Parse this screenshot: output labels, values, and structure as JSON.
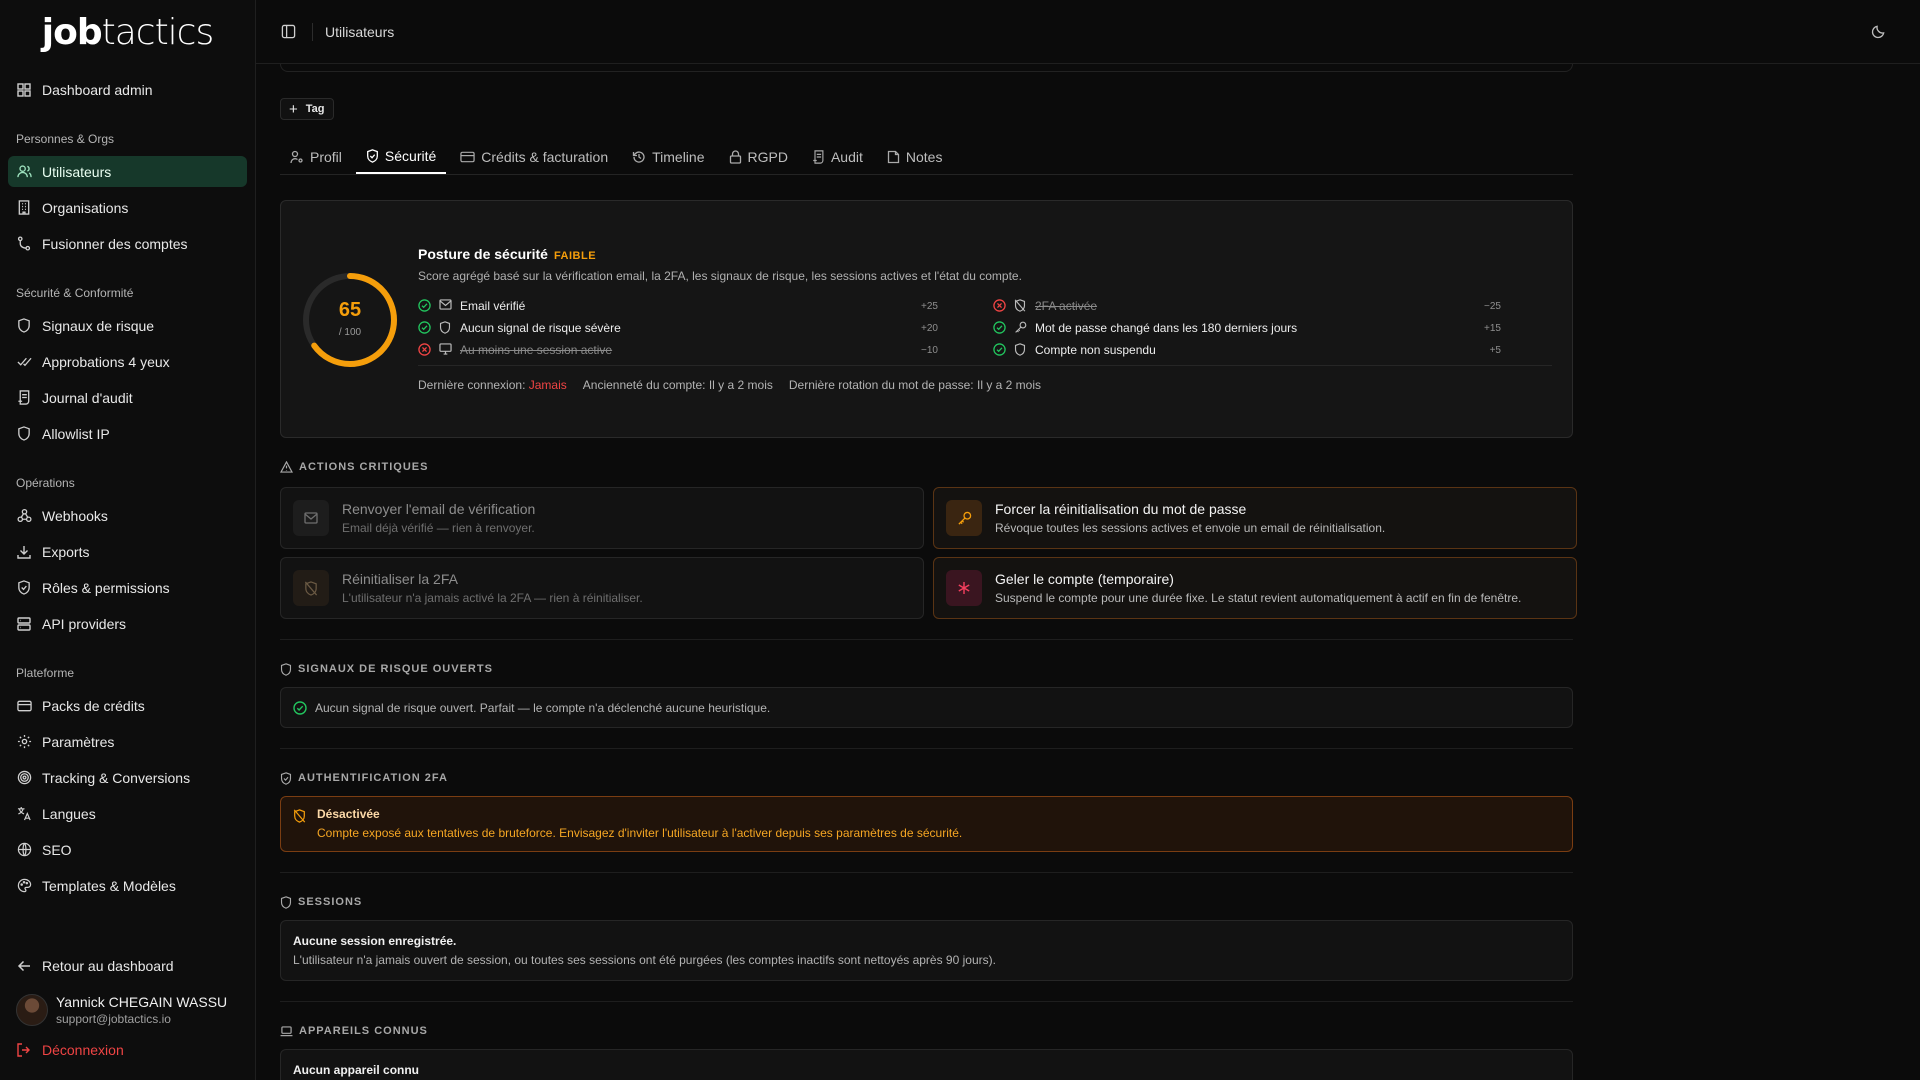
{
  "brand": {
    "part1": "job",
    "part2": "tactics"
  },
  "sidebar": {
    "top_item": {
      "label": "Dashboard admin",
      "icon": "grid-icon"
    },
    "sections": [
      {
        "title": "Personnes & Orgs",
        "items": [
          {
            "label": "Utilisateurs",
            "icon": "users-icon",
            "active": true
          },
          {
            "label": "Organisations",
            "icon": "building-icon"
          },
          {
            "label": "Fusionner des comptes",
            "icon": "merge-icon"
          }
        ]
      },
      {
        "title": "Sécurité & Conformité",
        "items": [
          {
            "label": "Signaux de risque",
            "icon": "shield-icon"
          },
          {
            "label": "Approbations 4 yeux",
            "icon": "double-check-icon"
          },
          {
            "label": "Journal d'audit",
            "icon": "scroll-icon"
          },
          {
            "label": "Allowlist IP",
            "icon": "shield-icon"
          }
        ]
      },
      {
        "title": "Opérations",
        "items": [
          {
            "label": "Webhooks",
            "icon": "webhook-icon"
          },
          {
            "label": "Exports",
            "icon": "download-icon"
          },
          {
            "label": "Rôles & permissions",
            "icon": "shield-check-icon"
          },
          {
            "label": "API providers",
            "icon": "server-icon"
          }
        ]
      },
      {
        "title": "Plateforme",
        "items": [
          {
            "label": "Packs de crédits",
            "icon": "card-icon"
          },
          {
            "label": "Paramètres",
            "icon": "gear-icon"
          },
          {
            "label": "Tracking & Conversions",
            "icon": "target-icon"
          },
          {
            "label": "Langues",
            "icon": "translate-icon"
          },
          {
            "label": "SEO",
            "icon": "globe-icon"
          },
          {
            "label": "Templates & Modèles",
            "icon": "palette-icon"
          }
        ]
      }
    ],
    "back_label": "Retour au dashboard",
    "user": {
      "name": "Yannick CHEGAIN WASSU",
      "email": "support@jobtactics.io"
    },
    "logout_label": "Déconnexion"
  },
  "topbar": {
    "breadcrumb": "Utilisateurs"
  },
  "tag_button": {
    "label": "Tag"
  },
  "tabs": [
    {
      "label": "Profil",
      "icon": "user-cog-icon"
    },
    {
      "label": "Sécurité",
      "icon": "shield-check-icon",
      "active": true
    },
    {
      "label": "Crédits & facturation",
      "icon": "card-icon"
    },
    {
      "label": "Timeline",
      "icon": "history-icon"
    },
    {
      "label": "RGPD",
      "icon": "lock-icon"
    },
    {
      "label": "Audit",
      "icon": "scroll-icon"
    },
    {
      "label": "Notes",
      "icon": "note-icon"
    }
  ],
  "posture": {
    "score": "65",
    "score_value": 65,
    "score_max": "/ 100",
    "title": "Posture de sécurité",
    "level": "FAIBLE",
    "subtitle": "Score agrégé basé sur la vérification email, la 2FA, les signaux de risque, les sessions actives et l'état du compte.",
    "checks_left": [
      {
        "label": "Email vérifié",
        "points": "+25",
        "ok": true,
        "icon": "mail-icon"
      },
      {
        "label": "Aucun signal de risque sévère",
        "points": "+20",
        "ok": true,
        "icon": "shield-icon"
      },
      {
        "label": "Au moins une session active",
        "points": "−10",
        "ok": false,
        "icon": "monitor-icon"
      }
    ],
    "checks_right": [
      {
        "label": "2FA activée",
        "points": "−25",
        "ok": false,
        "icon": "shield-off-icon"
      },
      {
        "label": "Mot de passe changé dans les 180 derniers jours",
        "points": "+15",
        "ok": true,
        "icon": "key-icon"
      },
      {
        "label": "Compte non suspendu",
        "points": "+5",
        "ok": true,
        "icon": "shield-icon"
      }
    ],
    "meta": {
      "last_login_label": "Dernière connexion:",
      "last_login_value": "Jamais",
      "seniority": "Ancienneté du compte: Il y a 2 mois",
      "pwd_rotation": "Dernière rotation du mot de passe: Il y a 2 mois"
    },
    "colors": {
      "accent": "#f59e0b",
      "ok": "#22c55e",
      "fail": "#ef4444"
    }
  },
  "critical": {
    "heading": "ACTIONS CRITIQUES",
    "actions": [
      {
        "title": "Renvoyer l'email de vérification",
        "desc": "Email déjà vérifié — rien à renvoyer.",
        "icon": "mail-icon",
        "enabled": false
      },
      {
        "title": "Forcer la réinitialisation du mot de passe",
        "desc": "Révoque toutes les sessions actives et envoie un email de réinitialisation.",
        "icon": "key-icon",
        "enabled": true
      },
      {
        "title": "Réinitialiser la 2FA",
        "desc": "L'utilisateur n'a jamais activé la 2FA — rien à réinitialiser.",
        "icon": "shield-off-icon",
        "enabled": false
      },
      {
        "title": "Geler le compte (temporaire)",
        "desc": "Suspend le compte pour une durée fixe. Le statut revient automatiquement à actif en fin de fenêtre.",
        "icon": "snowflake-icon",
        "enabled": true
      }
    ]
  },
  "risk": {
    "heading": "SIGNAUX DE RISQUE OUVERTS",
    "empty": "Aucun signal de risque ouvert. Parfait — le compte n'a déclenché aucune heuristique."
  },
  "twofa": {
    "heading": "AUTHENTIFICATION 2FA",
    "status": "Désactivée",
    "desc": "Compte exposé aux tentatives de bruteforce. Envisagez d'inviter l'utilisateur à l'activer depuis ses paramètres de sécurité."
  },
  "sessions": {
    "heading": "SESSIONS",
    "empty_title": "Aucune session enregistrée.",
    "empty_desc": "L'utilisateur n'a jamais ouvert de session, ou toutes ses sessions ont été purgées (les comptes inactifs sont nettoyés après 90 jours)."
  },
  "devices": {
    "heading": "APPAREILS CONNUS",
    "empty_title": "Aucun appareil connu"
  }
}
